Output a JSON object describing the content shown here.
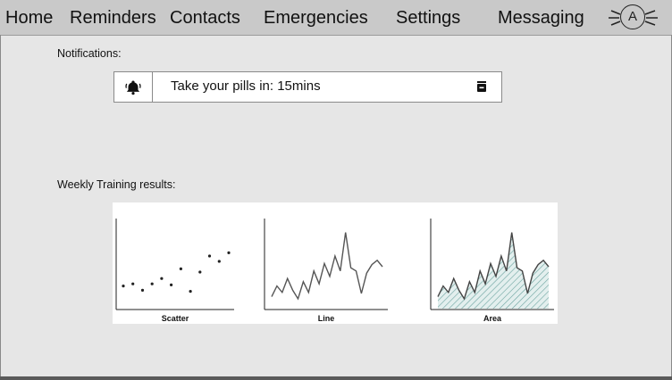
{
  "nav": {
    "items": [
      "Home",
      "Reminders",
      "Contacts",
      "Emergencies",
      "Settings",
      "Messaging"
    ],
    "avatar_initial": "A"
  },
  "notifications": {
    "heading": "Notifications:",
    "items": [
      {
        "icon": "bell-icon",
        "text": "Take your pills in: 15mins",
        "action_icon": "delete-icon"
      }
    ]
  },
  "training": {
    "heading": "Weekly Training results:"
  },
  "chart_data": [
    {
      "type": "scatter",
      "xlabel": "Scatter",
      "x": [
        1,
        2,
        3,
        4,
        5,
        6,
        7,
        8,
        9,
        10,
        11,
        12
      ],
      "y": [
        2.2,
        2.4,
        1.8,
        2.4,
        2.9,
        2.3,
        3.8,
        1.7,
        3.5,
        5.0,
        4.5,
        5.3
      ]
    },
    {
      "type": "line",
      "xlabel": "Line",
      "x": [
        1,
        2,
        3,
        4,
        5,
        6,
        7,
        8,
        9,
        10,
        11,
        12,
        13,
        14,
        15,
        16,
        17,
        18,
        19,
        20,
        21,
        22
      ],
      "y": [
        1.2,
        2.2,
        1.6,
        2.9,
        1.8,
        1.0,
        2.6,
        1.6,
        3.6,
        2.4,
        4.3,
        3.1,
        5.0,
        3.6,
        7.2,
        3.9,
        3.6,
        1.5,
        3.4,
        4.2,
        4.6,
        4.0
      ]
    },
    {
      "type": "area",
      "xlabel": "Area",
      "x": [
        1,
        2,
        3,
        4,
        5,
        6,
        7,
        8,
        9,
        10,
        11,
        12,
        13,
        14,
        15,
        16,
        17,
        18,
        19,
        20,
        21,
        22
      ],
      "y": [
        1.2,
        2.2,
        1.6,
        2.9,
        1.8,
        1.0,
        2.6,
        1.6,
        3.6,
        2.4,
        4.3,
        3.1,
        5.0,
        3.6,
        7.2,
        3.9,
        3.6,
        1.5,
        3.4,
        4.2,
        4.6,
        4.0
      ],
      "fill_color": "#9ec9c6"
    }
  ]
}
